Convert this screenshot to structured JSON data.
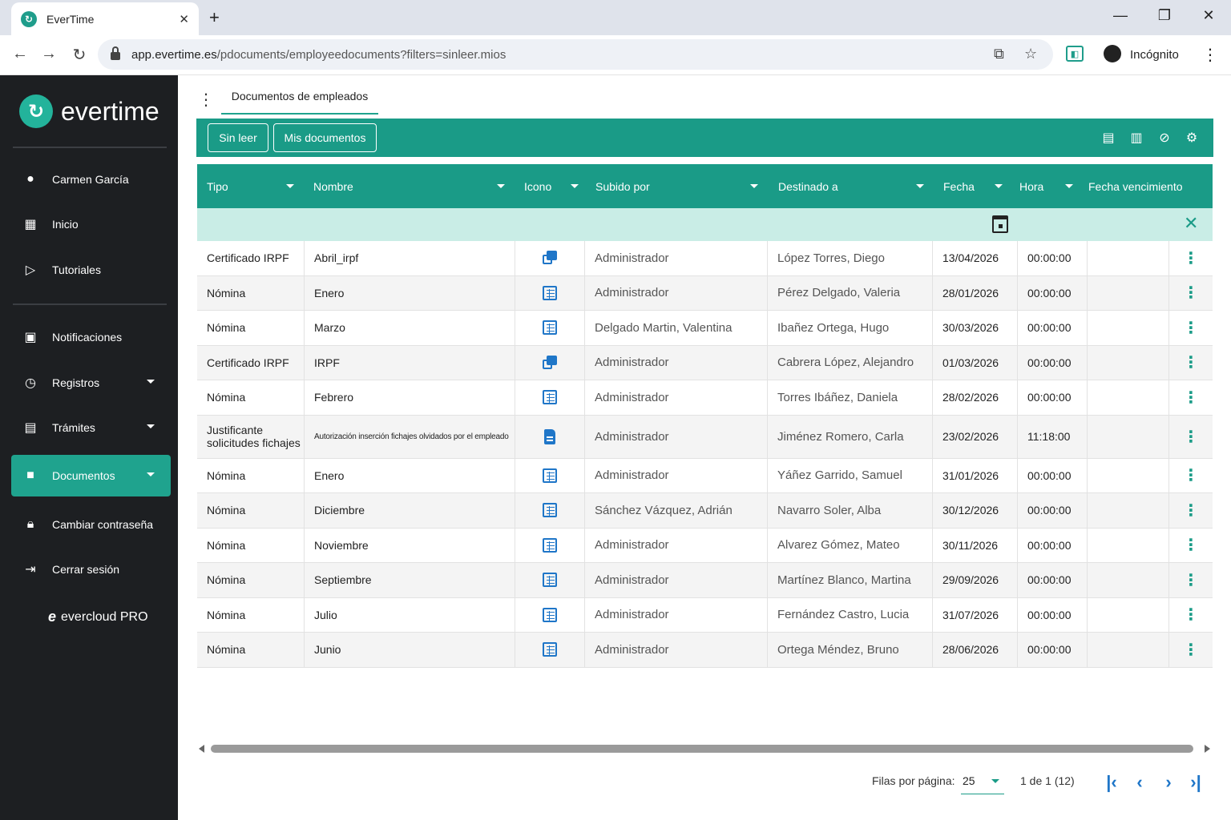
{
  "browser": {
    "tab_title": "EverTime",
    "tab_close": "✕",
    "new_tab": "+",
    "url_host": "app.evertime.es",
    "url_path": "/pdocuments/employeedocuments?filters=sinleer.mios",
    "profile_label": "Incógnito"
  },
  "sidebar": {
    "brand": "evertime",
    "user": "Carmen García",
    "items": [
      {
        "label": "Inicio"
      },
      {
        "label": "Tutoriales"
      },
      {
        "label": "Notificaciones"
      },
      {
        "label": "Registros"
      },
      {
        "label": "Trámites"
      },
      {
        "label": "Documentos"
      },
      {
        "label": "Cambiar contraseña"
      },
      {
        "label": "Cerrar sesión"
      }
    ],
    "footer": "evercloud PRO"
  },
  "page": {
    "tab_label": "Documentos de empleados"
  },
  "toolbar": {
    "btn_unread": "Sin leer",
    "btn_mine": "Mis documentos"
  },
  "table": {
    "columns": [
      "Tipo",
      "Nombre",
      "Icono",
      "Subido por",
      "Destinado a",
      "Fecha",
      "Hora",
      "Fecha vencimiento"
    ],
    "rows": [
      {
        "tipo": "Certificado IRPF",
        "nombre": "Abril_irpf",
        "icon": "copy",
        "subido": "Administrador",
        "destinado": "López Torres, Diego",
        "fecha": "13/04/2026",
        "hora": "00:00:00",
        "venc": ""
      },
      {
        "tipo": "Nómina",
        "nombre": "Enero",
        "icon": "table",
        "subido": "Administrador",
        "destinado": "Pérez Delgado, Valeria",
        "fecha": "28/01/2026",
        "hora": "00:00:00",
        "venc": ""
      },
      {
        "tipo": "Nómina",
        "nombre": "Marzo",
        "icon": "table",
        "subido": "Delgado Martin, Valentina",
        "destinado": "Ibañez Ortega, Hugo",
        "fecha": "30/03/2026",
        "hora": "00:00:00",
        "venc": ""
      },
      {
        "tipo": "Certificado IRPF",
        "nombre": "IRPF",
        "icon": "copy",
        "subido": "Administrador",
        "destinado": "Cabrera López, Alejandro",
        "fecha": "01/03/2026",
        "hora": "00:00:00",
        "venc": ""
      },
      {
        "tipo": "Nómina",
        "nombre": "Febrero",
        "icon": "table",
        "subido": "Administrador",
        "destinado": "Torres Ibáñez, Daniela",
        "fecha": "28/02/2026",
        "hora": "00:00:00",
        "venc": ""
      },
      {
        "tipo": "Justificante solicitudes fichajes",
        "nombre": "Autorización inserción fichajes olvidados por el empleado",
        "icon": "file",
        "subido": "Administrador",
        "destinado": "Jiménez Romero, Carla",
        "fecha": "23/02/2026",
        "hora": "11:18:00",
        "venc": ""
      },
      {
        "tipo": "Nómina",
        "nombre": "Enero",
        "icon": "table",
        "subido": "Administrador",
        "destinado": "Yáñez Garrido, Samuel",
        "fecha": "31/01/2026",
        "hora": "00:00:00",
        "venc": ""
      },
      {
        "tipo": "Nómina",
        "nombre": "Diciembre",
        "icon": "table",
        "subido": "Sánchez Vázquez, Adrián",
        "destinado": "Navarro Soler, Alba",
        "fecha": "30/12/2026",
        "hora": "00:00:00",
        "venc": ""
      },
      {
        "tipo": "Nómina",
        "nombre": "Noviembre",
        "icon": "table",
        "subido": "Administrador",
        "destinado": "Alvarez Gómez, Mateo",
        "fecha": "30/11/2026",
        "hora": "00:00:00",
        "venc": ""
      },
      {
        "tipo": "Nómina",
        "nombre": "Septiembre",
        "icon": "table",
        "subido": "Administrador",
        "destinado": "Martínez Blanco, Martina",
        "fecha": "29/09/2026",
        "hora": "00:00:00",
        "venc": ""
      },
      {
        "tipo": "Nómina",
        "nombre": "Julio",
        "icon": "table",
        "subido": "Administrador",
        "destinado": "Fernández Castro, Lucia",
        "fecha": "31/07/2026",
        "hora": "00:00:00",
        "venc": ""
      },
      {
        "tipo": "Nómina",
        "nombre": "Junio",
        "icon": "table",
        "subido": "Administrador",
        "destinado": "Ortega Méndez, Bruno",
        "fecha": "28/06/2026",
        "hora": "00:00:00",
        "venc": ""
      }
    ]
  },
  "pagination": {
    "rows_per_page_label": "Filas por página:",
    "rows_per_page": "25",
    "range": "1 de 1 (12)"
  },
  "colors": {
    "accent": "#1a9b87",
    "sidebar_bg": "#1d1f22",
    "icon_blue": "#1f76c8",
    "filter_row": "#c9ede6"
  }
}
